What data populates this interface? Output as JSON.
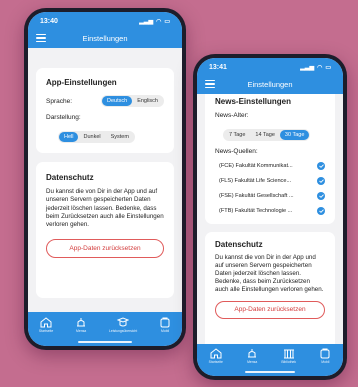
{
  "colors": {
    "background": "#c46d8f",
    "primary": "#2e8fe0",
    "danger": "#d23b3b"
  },
  "phone1": {
    "time": "13:40",
    "title": "Einstellungen",
    "app_settings": {
      "title": "App-Einstellungen",
      "language_label": "Sprache:",
      "language_options": [
        "Deutsch",
        "Englisch"
      ],
      "language_selected": "Deutsch",
      "theme_label": "Darstellung:",
      "theme_options": [
        "Hell",
        "Dunkel",
        "System"
      ],
      "theme_selected": "Hell"
    },
    "privacy": {
      "title": "Datenschutz",
      "text": "Du kannst die von Dir in der App und auf unseren Servern gespeicherten Daten jederzeit löschen lassen. Bedenke, dass beim Zurücksetzen auch alle Einstellungen verloren gehen.",
      "reset_label": "App-Daten zurücksetzen"
    },
    "tabs": [
      {
        "label": "Startseite",
        "icon": "home-icon"
      },
      {
        "label": "Mensa",
        "icon": "mensa-icon"
      },
      {
        "label": "Leistungsübersicht",
        "icon": "grades-icon"
      },
      {
        "label": "Mobil",
        "icon": "mobile-icon"
      }
    ]
  },
  "phone2": {
    "time": "13:41",
    "title": "Einstellungen",
    "news": {
      "title": "News-Einstellungen",
      "age_label": "News-Alter:",
      "age_options": [
        "7 Tage",
        "14 Tage",
        "30 Tage"
      ],
      "age_selected": "30 Tage",
      "sources_label": "News-Quellen:",
      "sources": [
        {
          "label": "(FCE) Fakultät Kommunikat...",
          "checked": true
        },
        {
          "label": "(FLS) Fakultät Life Science...",
          "checked": true
        },
        {
          "label": "(FSE) Fakultät Gesellschaft ...",
          "checked": true
        },
        {
          "label": "(FTB) Fakultät Technologie ...",
          "checked": true
        }
      ]
    },
    "privacy": {
      "title": "Datenschutz",
      "text": "Du kannst die von Dir in der App und auf unseren Servern gespeicherten Daten jederzeit löschen lassen. Bedenke, dass beim Zurücksetzen auch alle Einstellungen verloren gehen.",
      "reset_label": "App-Daten zurücksetzen"
    },
    "tabs": [
      {
        "label": "Startseite",
        "icon": "home-icon"
      },
      {
        "label": "Mensa",
        "icon": "mensa-icon"
      },
      {
        "label": "Bibliothek",
        "icon": "library-icon"
      },
      {
        "label": "Mobil",
        "icon": "mobile-icon"
      }
    ]
  }
}
